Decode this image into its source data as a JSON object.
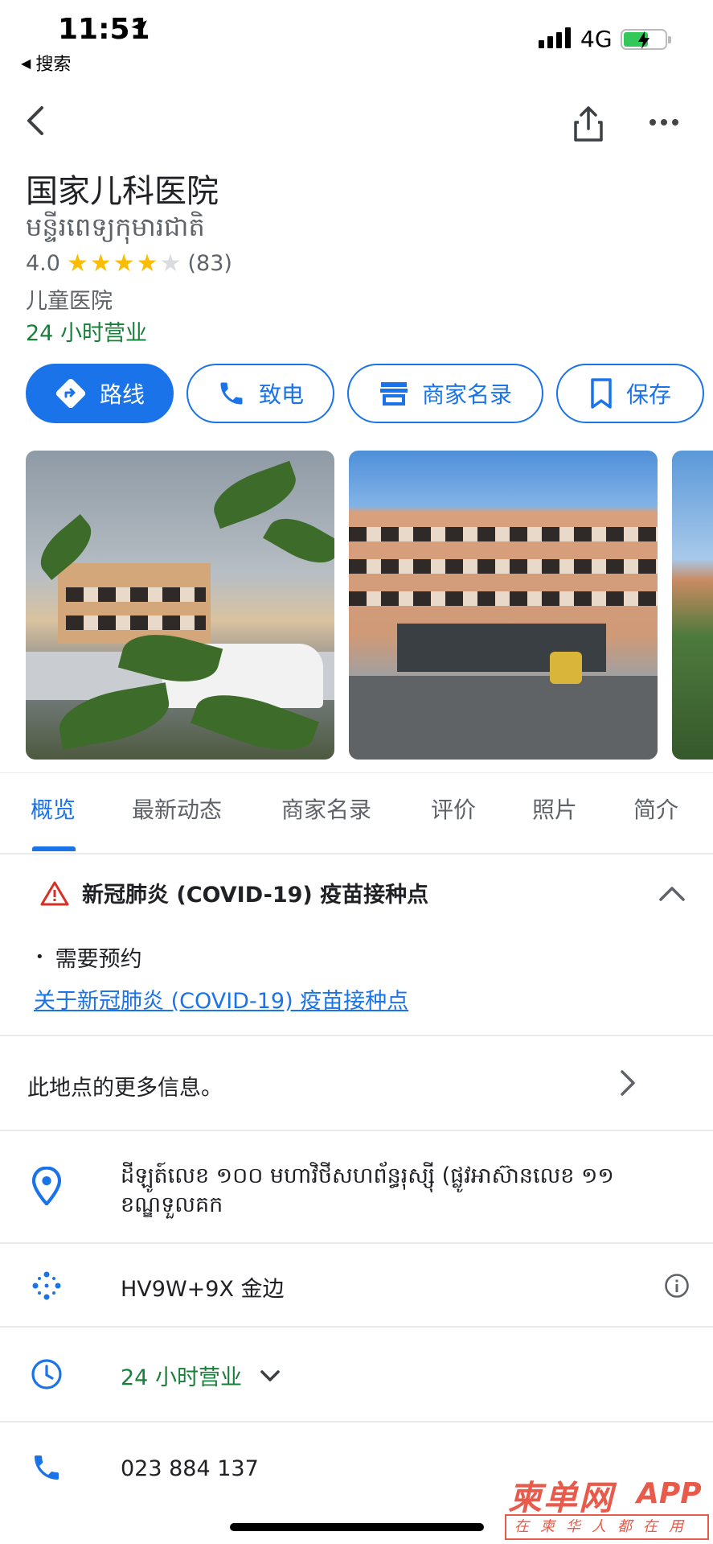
{
  "status_bar": {
    "time": "11:51",
    "back_app": "搜索",
    "network": "4G"
  },
  "place": {
    "name": "国家儿科医院",
    "local_name": "មន្ទីរពេទ្យកុមារជាតិ",
    "rating": "4.0",
    "stars": 4,
    "review_count": "(83)",
    "category": "儿童医院",
    "open_status": "24 小时营业"
  },
  "actions": {
    "route": "路线",
    "call": "致电",
    "directory": "商家名录",
    "save": "保存"
  },
  "tabs": [
    "概览",
    "最新动态",
    "商家名录",
    "评价",
    "照片",
    "简介"
  ],
  "covid": {
    "title": "新冠肺炎 (COVID-19) 疫苗接种点",
    "requirement": "需要预约",
    "link": "关于新冠肺炎 (COVID-19) 疫苗接种点"
  },
  "more_info": "此地点的更多信息。",
  "details": {
    "address": "ដីឡូត៍លេខ ១០០ មហាវិថីសហព័ន្ធរុស្ស៊ី (ផ្លូវអាស៊ានលេខ ១១ ខណ្ឌទួលគក",
    "plus_code": "HV9W+9X 金边",
    "hours": "24 小时营业",
    "phone": "023 884 137"
  },
  "watermark": {
    "brand": "柬单网",
    "app": "APP",
    "slogan": "在柬华人都在用"
  },
  "colors": {
    "accent": "#1a73e8",
    "open_green": "#188038",
    "star": "#fbbc04",
    "watermark": "#e85b4b"
  }
}
